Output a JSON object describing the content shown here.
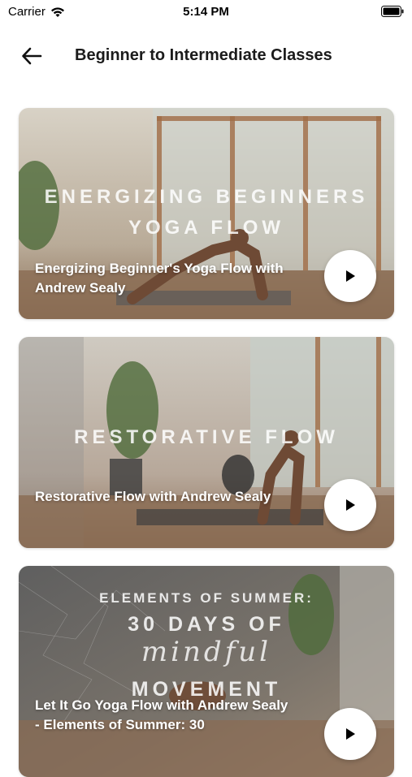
{
  "status": {
    "carrier": "Carrier",
    "time": "5:14 PM"
  },
  "header": {
    "title": "Beginner to Intermediate Classes"
  },
  "cards": [
    {
      "overlay_line1": "ENERGIZING BEGINNERS",
      "overlay_line2": "YOGA FLOW",
      "caption": "Energizing Beginner's Yoga Flow with Andrew Sealy"
    },
    {
      "overlay_line1": "RESTORATIVE FLOW",
      "caption": "Restorative Flow with Andrew Sealy"
    },
    {
      "overlay_line1": "ELEMENTS OF SUMMER:",
      "overlay_line2": "30 DAYS OF",
      "overlay_script": "mindful",
      "overlay_line3": "MOVEMENT",
      "caption": "Let It Go Yoga Flow with Andrew Sealy - Elements of Summer: 30"
    }
  ],
  "icons": [
    "wifi-icon",
    "battery-icon",
    "back-arrow-icon",
    "play-icon"
  ]
}
